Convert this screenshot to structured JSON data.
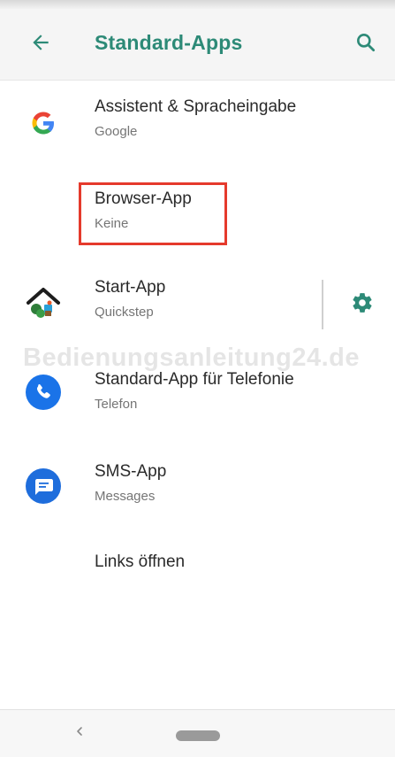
{
  "appbar": {
    "title": "Standard-Apps",
    "back_icon": "arrow-back-icon",
    "search_icon": "search-icon"
  },
  "colors": {
    "accent": "#2d8a77",
    "highlight": "#e53a2c",
    "phone_icon": "#1a73e8",
    "sms_icon": "#1e6ddc"
  },
  "items": [
    {
      "title": "Assistent & Spracheingabe",
      "subtitle": "Google",
      "icon": "google-g-icon"
    },
    {
      "title": "Browser-App",
      "subtitle": "Keine",
      "icon": ""
    },
    {
      "title": "Start-App",
      "subtitle": "Quickstep",
      "icon": "home-launcher-icon",
      "action_icon": "gear-icon"
    },
    {
      "title": "Standard-App für Telefonie",
      "subtitle": "Telefon",
      "icon": "phone-icon"
    },
    {
      "title": "SMS-App",
      "subtitle": "Messages",
      "icon": "sms-messages-icon"
    },
    {
      "title": "Links öffnen",
      "subtitle": ""
    }
  ],
  "watermark": "Bedienungsanleitung24.de",
  "navbar": {
    "back_icon": "nav-back-icon",
    "home_icon": "nav-home-pill-icon"
  }
}
